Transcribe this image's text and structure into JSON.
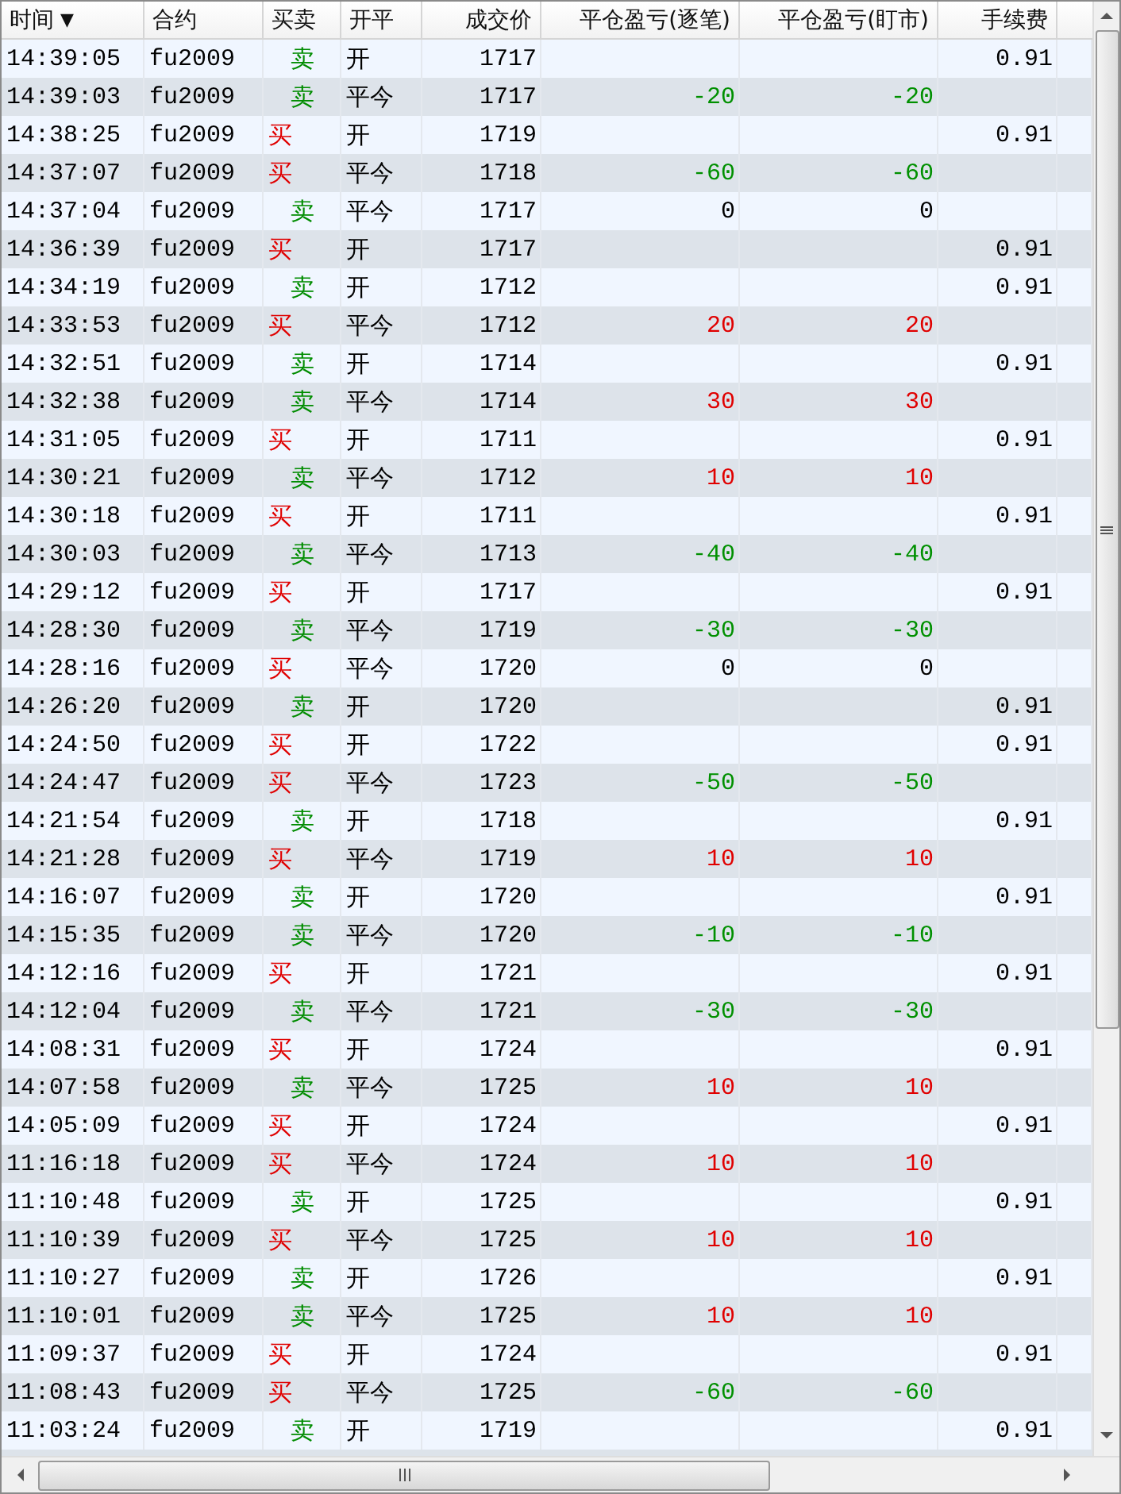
{
  "columns": [
    {
      "label": "时间",
      "sort_mark": "▼"
    },
    {
      "label": "合约"
    },
    {
      "label": "买卖"
    },
    {
      "label": "开平"
    },
    {
      "label": "成交价"
    },
    {
      "label": "平仓盈亏(逐笔)"
    },
    {
      "label": "平仓盈亏(盯市)"
    },
    {
      "label": "手续费"
    }
  ],
  "rows": [
    {
      "time": "14:39:05",
      "contract": "fu2009",
      "side": "卖",
      "kind": "sell",
      "open_close": "开",
      "price": "1717",
      "fee": "0.91"
    },
    {
      "time": "14:39:03",
      "contract": "fu2009",
      "side": "卖",
      "kind": "sell",
      "open_close": "平今",
      "price": "1717",
      "pnl": "-20",
      "pnl_mtm": "-20",
      "color": "#009000"
    },
    {
      "time": "14:38:25",
      "contract": "fu2009",
      "side": "买",
      "kind": "buy",
      "open_close": "开",
      "price": "1719",
      "fee": "0.91"
    },
    {
      "time": "14:37:07",
      "contract": "fu2009",
      "side": "买",
      "kind": "buy",
      "open_close": "平今",
      "price": "1718",
      "pnl": "-60",
      "pnl_mtm": "-60",
      "color": "#009000"
    },
    {
      "time": "14:37:04",
      "contract": "fu2009",
      "side": "卖",
      "kind": "sell",
      "open_close": "平今",
      "price": "1717",
      "pnl": "0",
      "pnl_mtm": "0",
      "color": "#000000"
    },
    {
      "time": "14:36:39",
      "contract": "fu2009",
      "side": "买",
      "kind": "buy",
      "open_close": "开",
      "price": "1717",
      "fee": "0.91"
    },
    {
      "time": "14:34:19",
      "contract": "fu2009",
      "side": "卖",
      "kind": "sell",
      "open_close": "开",
      "price": "1712",
      "fee": "0.91"
    },
    {
      "time": "14:33:53",
      "contract": "fu2009",
      "side": "买",
      "kind": "buy",
      "open_close": "平今",
      "price": "1712",
      "pnl": "20",
      "pnl_mtm": "20",
      "color": "#e00000"
    },
    {
      "time": "14:32:51",
      "contract": "fu2009",
      "side": "卖",
      "kind": "sell",
      "open_close": "开",
      "price": "1714",
      "fee": "0.91"
    },
    {
      "time": "14:32:38",
      "contract": "fu2009",
      "side": "卖",
      "kind": "sell",
      "open_close": "平今",
      "price": "1714",
      "pnl": "30",
      "pnl_mtm": "30",
      "color": "#e00000"
    },
    {
      "time": "14:31:05",
      "contract": "fu2009",
      "side": "买",
      "kind": "buy",
      "open_close": "开",
      "price": "1711",
      "fee": "0.91"
    },
    {
      "time": "14:30:21",
      "contract": "fu2009",
      "side": "卖",
      "kind": "sell",
      "open_close": "平今",
      "price": "1712",
      "pnl": "10",
      "pnl_mtm": "10",
      "color": "#e00000"
    },
    {
      "time": "14:30:18",
      "contract": "fu2009",
      "side": "买",
      "kind": "buy",
      "open_close": "开",
      "price": "1711",
      "fee": "0.91"
    },
    {
      "time": "14:30:03",
      "contract": "fu2009",
      "side": "卖",
      "kind": "sell",
      "open_close": "平今",
      "price": "1713",
      "pnl": "-40",
      "pnl_mtm": "-40",
      "color": "#009000"
    },
    {
      "time": "14:29:12",
      "contract": "fu2009",
      "side": "买",
      "kind": "buy",
      "open_close": "开",
      "price": "1717",
      "fee": "0.91"
    },
    {
      "time": "14:28:30",
      "contract": "fu2009",
      "side": "卖",
      "kind": "sell",
      "open_close": "平今",
      "price": "1719",
      "pnl": "-30",
      "pnl_mtm": "-30",
      "color": "#009000"
    },
    {
      "time": "14:28:16",
      "contract": "fu2009",
      "side": "买",
      "kind": "buy",
      "open_close": "平今",
      "price": "1720",
      "pnl": "0",
      "pnl_mtm": "0",
      "color": "#000000"
    },
    {
      "time": "14:26:20",
      "contract": "fu2009",
      "side": "卖",
      "kind": "sell",
      "open_close": "开",
      "price": "1720",
      "fee": "0.91"
    },
    {
      "time": "14:24:50",
      "contract": "fu2009",
      "side": "买",
      "kind": "buy",
      "open_close": "开",
      "price": "1722",
      "fee": "0.91"
    },
    {
      "time": "14:24:47",
      "contract": "fu2009",
      "side": "买",
      "kind": "buy",
      "open_close": "平今",
      "price": "1723",
      "pnl": "-50",
      "pnl_mtm": "-50",
      "color": "#009000"
    },
    {
      "time": "14:21:54",
      "contract": "fu2009",
      "side": "卖",
      "kind": "sell",
      "open_close": "开",
      "price": "1718",
      "fee": "0.91"
    },
    {
      "time": "14:21:28",
      "contract": "fu2009",
      "side": "买",
      "kind": "buy",
      "open_close": "平今",
      "price": "1719",
      "pnl": "10",
      "pnl_mtm": "10",
      "color": "#e00000"
    },
    {
      "time": "14:16:07",
      "contract": "fu2009",
      "side": "卖",
      "kind": "sell",
      "open_close": "开",
      "price": "1720",
      "fee": "0.91"
    },
    {
      "time": "14:15:35",
      "contract": "fu2009",
      "side": "卖",
      "kind": "sell",
      "open_close": "平今",
      "price": "1720",
      "pnl": "-10",
      "pnl_mtm": "-10",
      "color": "#009000"
    },
    {
      "time": "14:12:16",
      "contract": "fu2009",
      "side": "买",
      "kind": "buy",
      "open_close": "开",
      "price": "1721",
      "fee": "0.91"
    },
    {
      "time": "14:12:04",
      "contract": "fu2009",
      "side": "卖",
      "kind": "sell",
      "open_close": "平今",
      "price": "1721",
      "pnl": "-30",
      "pnl_mtm": "-30",
      "color": "#009000"
    },
    {
      "time": "14:08:31",
      "contract": "fu2009",
      "side": "买",
      "kind": "buy",
      "open_close": "开",
      "price": "1724",
      "fee": "0.91"
    },
    {
      "time": "14:07:58",
      "contract": "fu2009",
      "side": "卖",
      "kind": "sell",
      "open_close": "平今",
      "price": "1725",
      "pnl": "10",
      "pnl_mtm": "10",
      "color": "#e00000"
    },
    {
      "time": "14:05:09",
      "contract": "fu2009",
      "side": "买",
      "kind": "buy",
      "open_close": "开",
      "price": "1724",
      "fee": "0.91"
    },
    {
      "time": "11:16:18",
      "contract": "fu2009",
      "side": "买",
      "kind": "buy",
      "open_close": "平今",
      "price": "1724",
      "pnl": "10",
      "pnl_mtm": "10",
      "color": "#e00000"
    },
    {
      "time": "11:10:48",
      "contract": "fu2009",
      "side": "卖",
      "kind": "sell",
      "open_close": "开",
      "price": "1725",
      "fee": "0.91"
    },
    {
      "time": "11:10:39",
      "contract": "fu2009",
      "side": "买",
      "kind": "buy",
      "open_close": "平今",
      "price": "1725",
      "pnl": "10",
      "pnl_mtm": "10",
      "color": "#e00000"
    },
    {
      "time": "11:10:27",
      "contract": "fu2009",
      "side": "卖",
      "kind": "sell",
      "open_close": "开",
      "price": "1726",
      "fee": "0.91"
    },
    {
      "time": "11:10:01",
      "contract": "fu2009",
      "side": "卖",
      "kind": "sell",
      "open_close": "平今",
      "price": "1725",
      "pnl": "10",
      "pnl_mtm": "10",
      "color": "#e00000"
    },
    {
      "time": "11:09:37",
      "contract": "fu2009",
      "side": "买",
      "kind": "buy",
      "open_close": "开",
      "price": "1724",
      "fee": "0.91"
    },
    {
      "time": "11:08:43",
      "contract": "fu2009",
      "side": "买",
      "kind": "buy",
      "open_close": "平今",
      "price": "1725",
      "pnl": "-60",
      "pnl_mtm": "-60",
      "color": "#009000"
    },
    {
      "time": "11:03:24",
      "contract": "fu2009",
      "side": "卖",
      "kind": "sell",
      "open_close": "开",
      "price": "1719",
      "fee": "0.91"
    }
  ]
}
